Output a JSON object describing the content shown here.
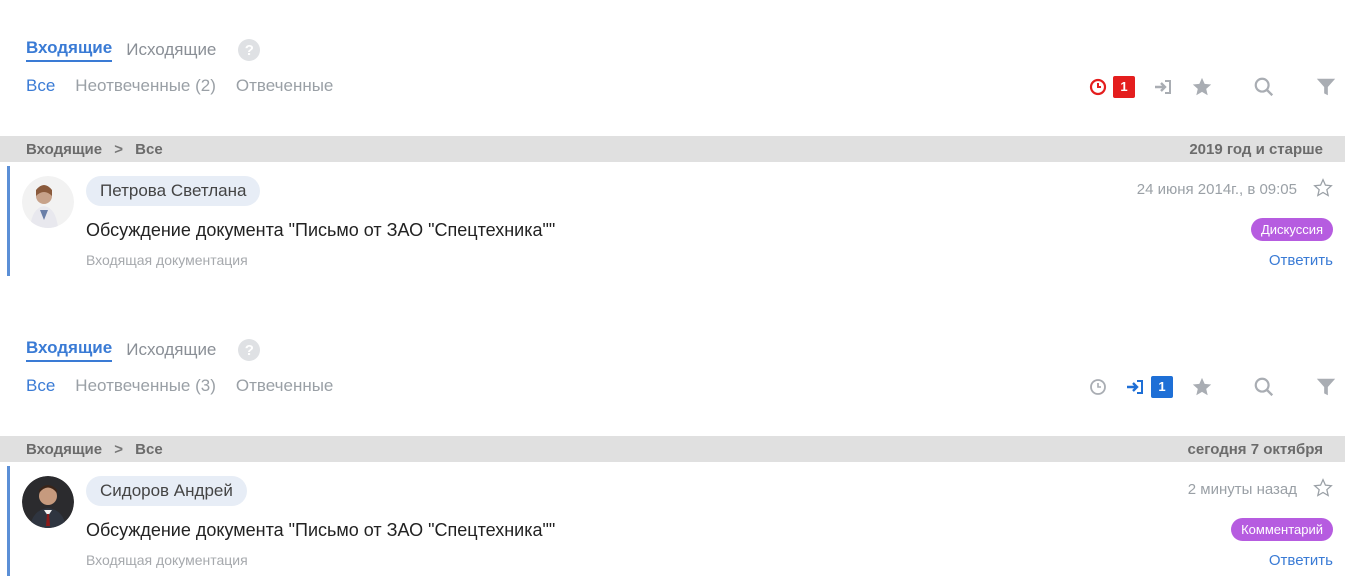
{
  "panels": [
    {
      "tabs": {
        "incoming": "Входящие",
        "outgoing": "Исходящие",
        "help": "?"
      },
      "filters": {
        "all": "Все",
        "unanswered": "Неотвеченные (2)",
        "answered": "Отвеченные"
      },
      "tools": {
        "overdue_count": "1",
        "reassigned_count": ""
      },
      "breadcrumb": {
        "root": "Входящие",
        "sep": ">",
        "current": "Все"
      },
      "period": "2019 год и старше",
      "message": {
        "sender": "Петрова Светлана",
        "subject": "Обсуждение документа \"Письмо от ЗАО \"Спецтехника\"\"",
        "category": "Входящая документация",
        "time": "24 июня 2014г., в 09:05",
        "tag": "Дискуссия",
        "reply": "Ответить"
      }
    },
    {
      "tabs": {
        "incoming": "Входящие",
        "outgoing": "Исходящие",
        "help": "?"
      },
      "filters": {
        "all": "Все",
        "unanswered": "Неотвеченные (3)",
        "answered": "Отвеченные"
      },
      "tools": {
        "overdue_count": "",
        "reassigned_count": "1"
      },
      "breadcrumb": {
        "root": "Входящие",
        "sep": ">",
        "current": "Все"
      },
      "period": "сегодня 7 октября",
      "message": {
        "sender": "Сидоров Андрей",
        "subject": "Обсуждение документа \"Письмо от ЗАО \"Спецтехника\"\"",
        "category": "Входящая документация",
        "time": "2 минуты назад",
        "tag": "Комментарий",
        "reply": "Ответить"
      }
    }
  ],
  "colors": {
    "accent": "#3a7bd5",
    "overdue": "#e41e1e",
    "tag": "#b65ce0",
    "badge_blue": "#1e6fd6"
  },
  "icons": [
    "help-icon",
    "clock-icon",
    "sign-in-icon",
    "star-icon",
    "search-icon",
    "filter-icon",
    "star-outline-icon"
  ]
}
